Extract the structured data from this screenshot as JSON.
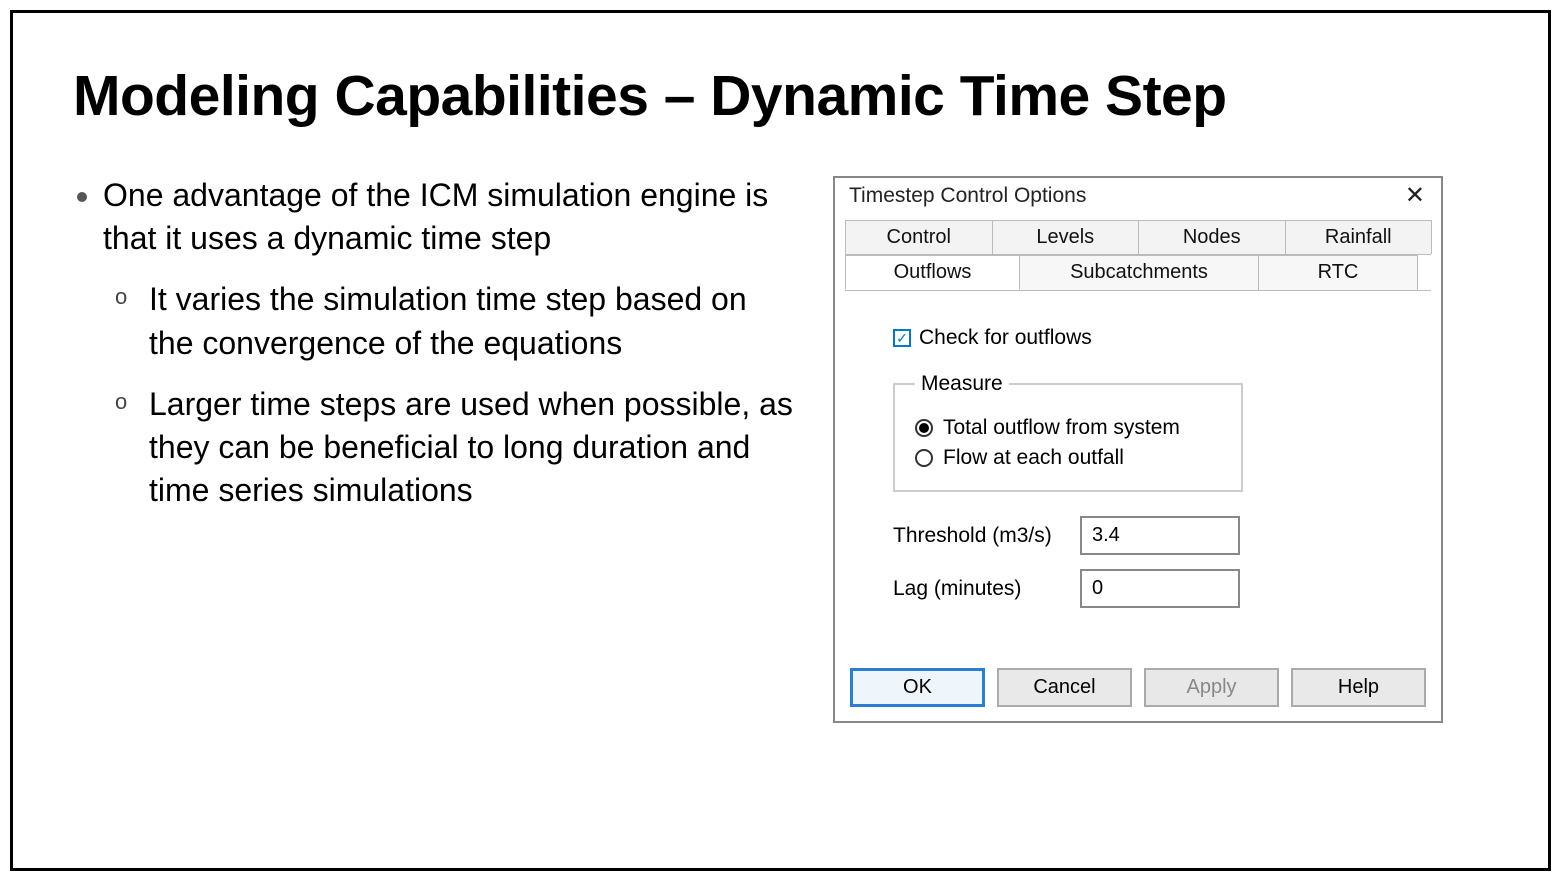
{
  "slide": {
    "title": "Modeling Capabilities – Dynamic Time Step",
    "bullet1": "One advantage of the ICM simulation engine is that it uses a dynamic time step",
    "sub1": "It varies the simulation time step based on the convergence of the equations",
    "sub2": "Larger time steps are used when possible, as they can be beneficial to long duration and time series simulations"
  },
  "dialog": {
    "title": "Timestep Control Options",
    "close_glyph": "✕",
    "tabs_row1": {
      "control": "Control",
      "levels": "Levels",
      "nodes": "Nodes",
      "rainfall": "Rainfall"
    },
    "tabs_row2": {
      "outflows": "Outflows",
      "subcatchments": "Subcatchments",
      "rtc": "RTC"
    },
    "checkbox_glyph": "✓",
    "checkbox_label": "Check for outflows",
    "measure_legend": "Measure",
    "radio_total": "Total outflow from system",
    "radio_each": "Flow at each outfall",
    "threshold_label": "Threshold (m3/s)",
    "threshold_value": "3.4",
    "lag_label": "Lag (minutes)",
    "lag_value": "0",
    "buttons": {
      "ok": "OK",
      "cancel": "Cancel",
      "apply": "Apply",
      "help": "Help"
    }
  }
}
